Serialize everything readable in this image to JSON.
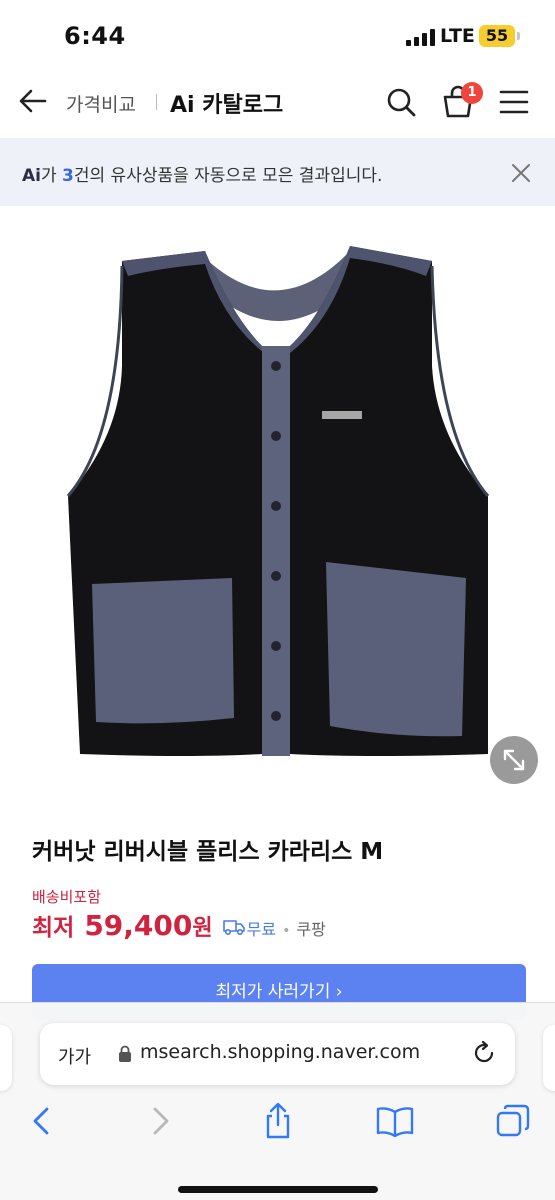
{
  "status_bar": {
    "time": "6:44",
    "network": "LTE",
    "battery": "55"
  },
  "header": {
    "crumb_compare": "가격비교",
    "crumb_catalog": "Ai 카탈로그",
    "cart_count": "1",
    "icons": [
      "back-arrow-icon",
      "search-icon",
      "cart-icon",
      "menu-icon"
    ]
  },
  "ai_notice": {
    "logo": "Ai",
    "before": "가 ",
    "count": "3",
    "after": "건의 유사상품을 자동으로 모은 결과입니다."
  },
  "product": {
    "title": "커버낫 리버시블 플리스 카라리스 M",
    "free_shipping": "배송비포함",
    "price_label": "최저",
    "price_value": "59,400",
    "price_unit": "원",
    "shipping": "무료",
    "store": "쿠팡",
    "buy_label": "최저가 사러가기 ›",
    "image_alt": "vest"
  },
  "browser": {
    "text_size_label": "가가",
    "url": "msearch.shopping.naver.com",
    "icons": [
      "back-icon",
      "forward-icon",
      "share-icon",
      "bookmarks-icon",
      "tabs-icon"
    ]
  },
  "colors": {
    "price_red": "#d0233f",
    "accent_blue": "#5b82f0",
    "badge_red": "#f0453a",
    "notice_bg": "#eef1f7"
  }
}
